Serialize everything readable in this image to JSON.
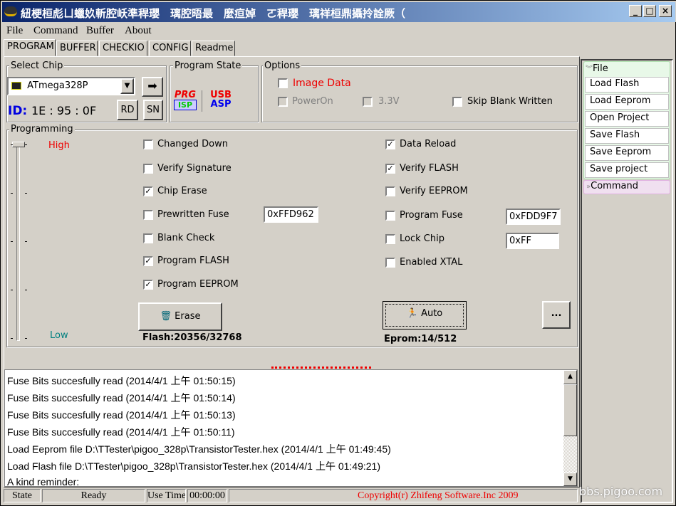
{
  "window": {
    "title": "紐梗桓彪ㄩ蠟奺斬腔岆準稈瓔　璃腔晤最　麼疸婥　ㄛ稈瓔　璃祥桓鼎攝拎詮厥（",
    "controls": [
      "_",
      "□",
      "×"
    ]
  },
  "menu": [
    "File",
    "Command",
    "Buffer",
    "About"
  ],
  "tabs": [
    "PROGRAM",
    "BUFFER",
    "CHECKIO",
    "CONFIG",
    "Readme"
  ],
  "select_chip": {
    "label": "Select Chip",
    "chip": "ATmega328P",
    "id_label": "ID:",
    "id_value": "1E : 95 : 0F",
    "rd": "RD",
    "sn": "SN"
  },
  "program_state": {
    "label": "Program State",
    "prg": "PRG",
    "isp": "ISP",
    "usb": "USB",
    "asp": "ASP"
  },
  "options": {
    "label": "Options",
    "image_data": {
      "label": "Image Data",
      "checked": false
    },
    "power_on": {
      "label": "PowerOn",
      "checked": false,
      "disabled": true
    },
    "v33": {
      "label": "3.3V",
      "checked": false,
      "disabled": true
    },
    "skip_blank": {
      "label": "Skip Blank Written",
      "checked": false
    }
  },
  "programming": {
    "label": "Programming",
    "high": "High",
    "low": "Low",
    "left": [
      {
        "label": "Changed Down",
        "checked": false
      },
      {
        "label": "Verify Signature",
        "checked": false
      },
      {
        "label": "Chip Erase",
        "checked": true
      },
      {
        "label": "Prewritten Fuse",
        "checked": false
      },
      {
        "label": "Blank Check",
        "checked": false
      },
      {
        "label": "Program FLASH",
        "checked": true
      },
      {
        "label": "Program EEPROM",
        "checked": true
      }
    ],
    "right": [
      {
        "label": "Data Reload",
        "checked": true
      },
      {
        "label": "Verify FLASH",
        "checked": true
      },
      {
        "label": "Verify EEPROM",
        "checked": false
      },
      {
        "label": "Program Fuse",
        "checked": false
      },
      {
        "label": "Lock Chip",
        "checked": false
      },
      {
        "label": "Enabled XTAL",
        "checked": false
      }
    ],
    "prewritten_fuse_value": "0xFFD962",
    "program_fuse_value": "0xFDD9F7",
    "lock_value": "0xFF",
    "erase": "Erase",
    "auto": "Auto",
    "more": "...",
    "flash": "Flash:20356/32768",
    "eprom": "Eprom:14/512"
  },
  "log": [
    "Fuse Bits succesfully read (2014/4/1 上午 01:50:15)",
    "Fuse Bits succesfully read (2014/4/1 上午 01:50:14)",
    "Fuse Bits succesfully read (2014/4/1 上午 01:50:13)",
    "Fuse Bits succesfully read (2014/4/1 上午 01:50:11)",
    "Load Eeprom file D:\\TTester\\pigoo_328p\\TransistorTester.hex (2014/4/1 上午 01:49:45)",
    "Load Flash file D:\\TTester\\pigoo_328p\\TransistorTester.hex (2014/4/1 上午 01:49:21)",
    "A kind reminder:"
  ],
  "status": {
    "state": "State",
    "ready": "Ready",
    "use_time": "Use Time:",
    "time": "00:00:00",
    "copyright": "Copyright(r) Zhifeng Software.Inc 2009"
  },
  "side": {
    "file": "File",
    "items": [
      "Load Flash",
      "Load Eeprom",
      "Open Project",
      "Save Flash",
      "Save Eeprom",
      "Save project"
    ],
    "command": "Command"
  },
  "watermark": "bbs.pigoo.com"
}
